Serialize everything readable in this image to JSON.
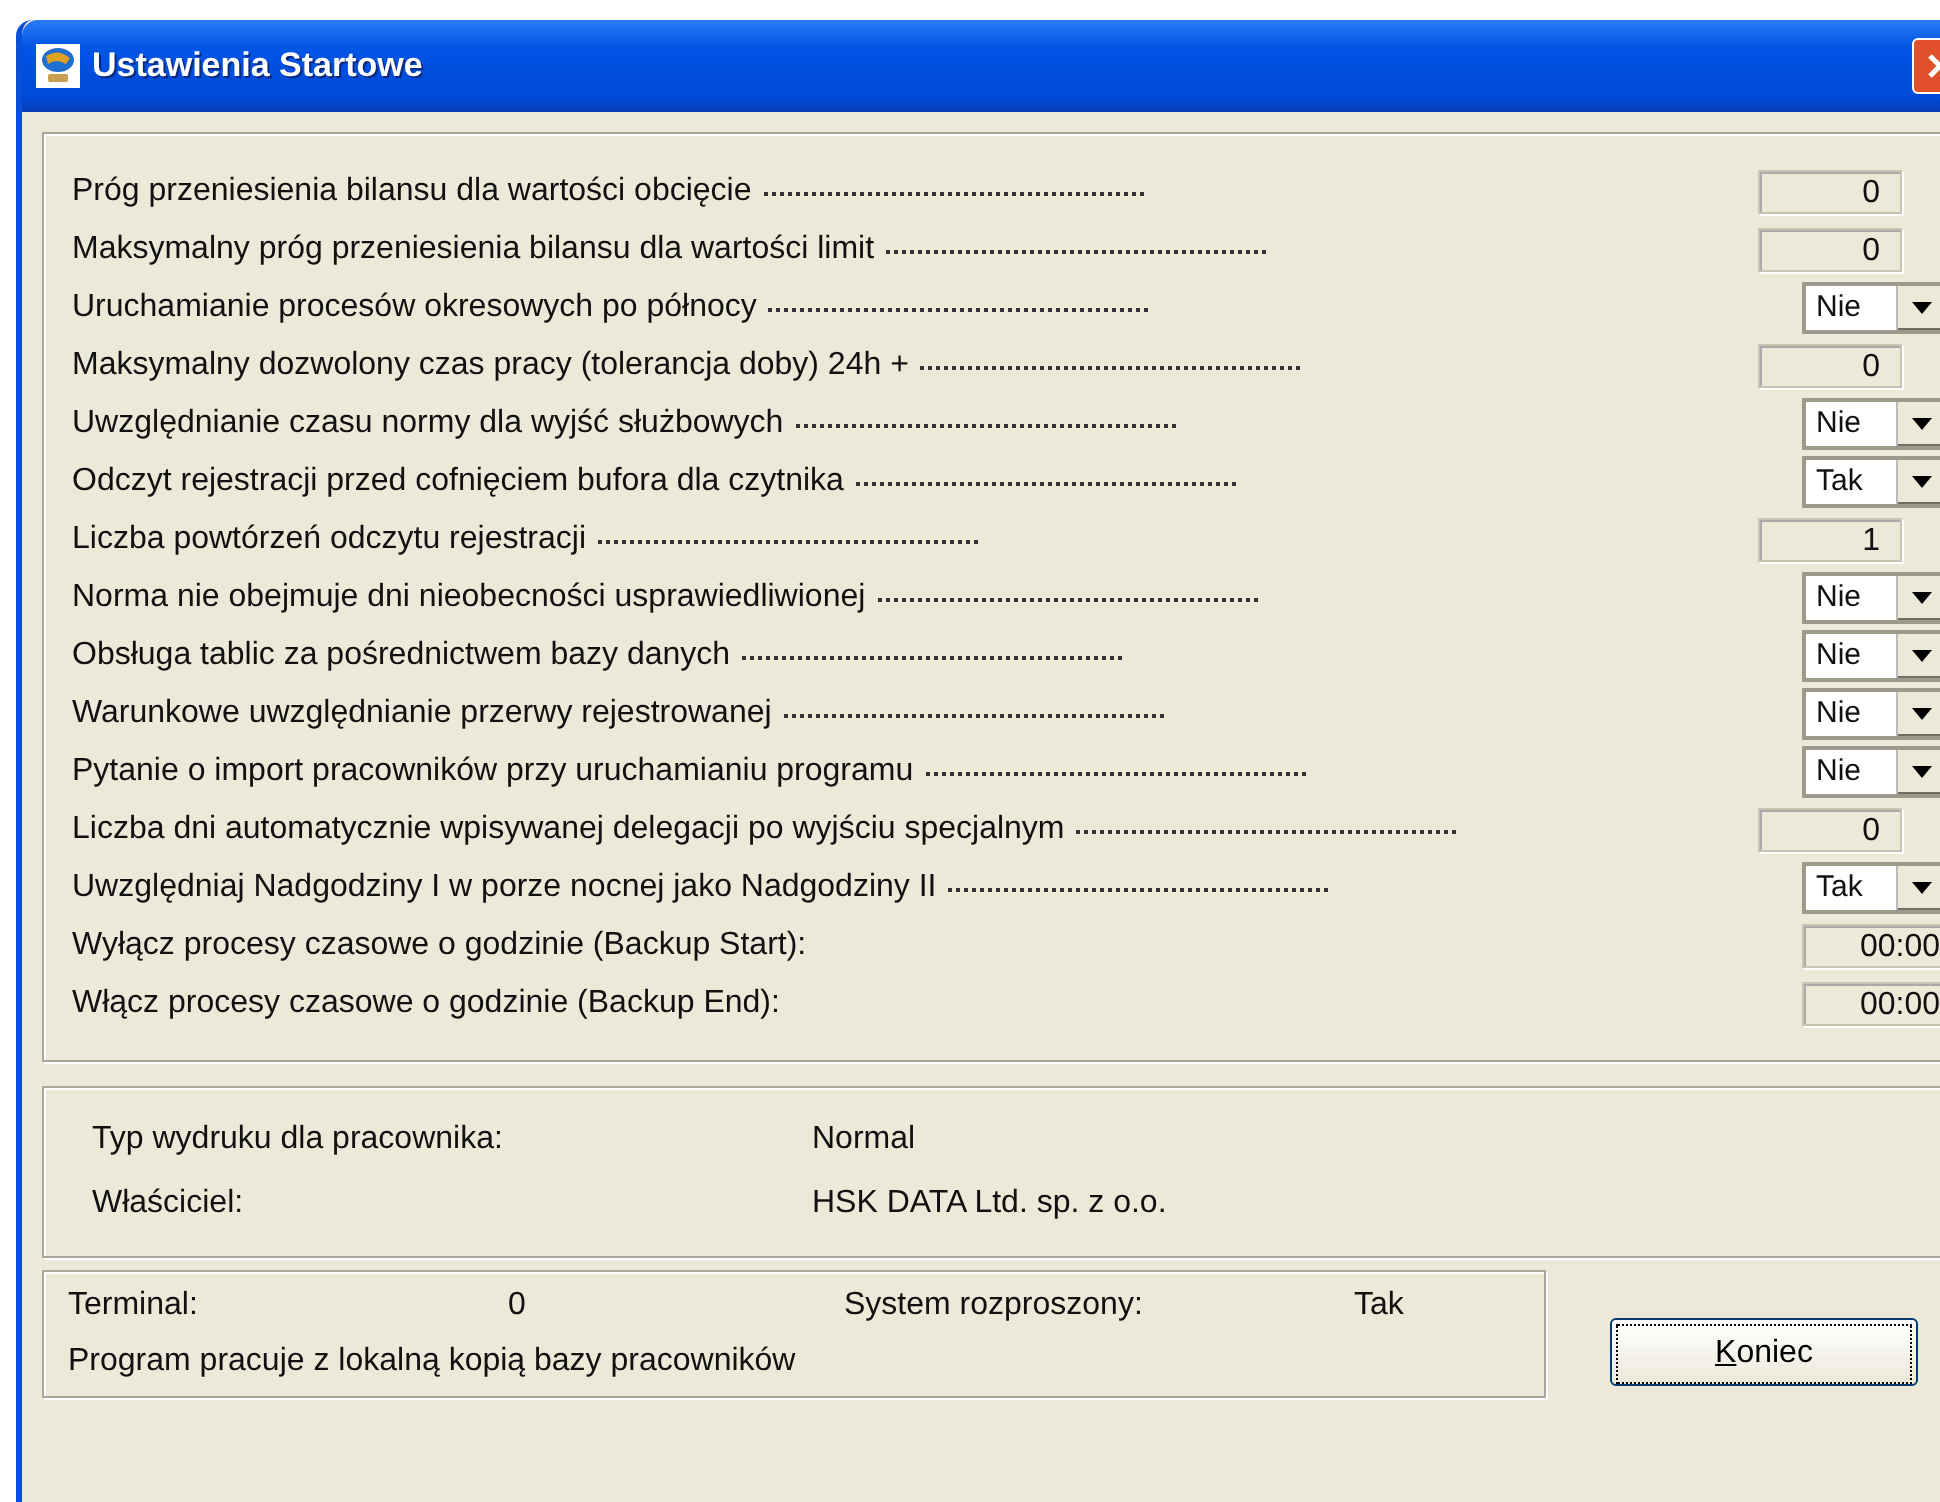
{
  "window": {
    "title": "Ustawienia Startowe"
  },
  "settings": [
    {
      "label": "Próg przeniesienia bilansu dla wartości obcięcie",
      "kind": "number",
      "value": "0"
    },
    {
      "label": "Maksymalny próg przeniesienia bilansu dla wartości limit",
      "kind": "number",
      "value": "0"
    },
    {
      "label": "Uruchamianie procesów okresowych po północy",
      "kind": "combo",
      "value": "Nie"
    },
    {
      "label": "Maksymalny dozwolony czas pracy (tolerancja doby)  24h +",
      "kind": "number",
      "value": "0"
    },
    {
      "label": "Uwzględnianie czasu normy dla wyjść służbowych",
      "kind": "combo",
      "value": "Nie"
    },
    {
      "label": "Odczyt rejestracji przed cofnięciem bufora dla czytnika",
      "kind": "combo",
      "value": "Tak"
    },
    {
      "label": "Liczba powtórzeń odczytu rejestracji",
      "kind": "number",
      "value": "1"
    },
    {
      "label": "Norma nie obejmuje dni nieobecności usprawiedliwionej",
      "kind": "combo",
      "value": "Nie"
    },
    {
      "label": "Obsługa tablic za pośrednictwem bazy danych",
      "kind": "combo",
      "value": "Nie"
    },
    {
      "label": "Warunkowe uwzględnianie przerwy rejestrowanej",
      "kind": "combo",
      "value": "Nie"
    },
    {
      "label": "Pytanie o import pracowników przy uruchamianiu programu",
      "kind": "combo",
      "value": "Nie"
    },
    {
      "label": "Liczba dni automatycznie wpisywanej delegacji po wyjściu specjalnym",
      "kind": "number",
      "value": "0"
    },
    {
      "label": "Uwzględniaj Nadgodziny I w porze nocnej jako Nadgodziny II",
      "kind": "combo",
      "value": "Tak"
    },
    {
      "label": "Wyłącz procesy czasowe o godzinie (Backup Start):",
      "kind": "time",
      "value": "00:00"
    },
    {
      "label": "Włącz procesy czasowe o godzinie (Backup End):",
      "kind": "time",
      "value": "00:00"
    }
  ],
  "info": [
    {
      "label": "Typ wydruku dla pracownika:",
      "value": "Normal"
    },
    {
      "label": "Właściciel:",
      "value": "HSK DATA Ltd. sp. z o.o."
    }
  ],
  "status": {
    "terminal_label": "Terminal:",
    "terminal_value": "0",
    "distributed_label": "System rozproszony:",
    "distributed_value": "Tak",
    "note": "Program pracuje z lokalną kopią bazy pracowników"
  },
  "close_button": {
    "access_key": "K",
    "label_rest": "oniec"
  }
}
